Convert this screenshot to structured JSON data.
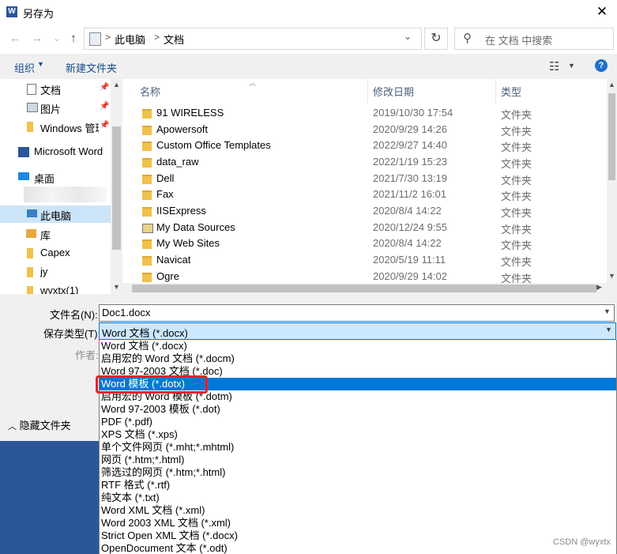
{
  "window": {
    "title": "另存为",
    "close_glyph": "✕"
  },
  "address": {
    "back": "←",
    "forward": "→",
    "recent": "⌄",
    "up": "↑",
    "segments": [
      "此电脑",
      "文档"
    ],
    "separator": ">",
    "dropdown": "⌄",
    "refresh": "↻",
    "search_placeholder": "在 文档 中搜索"
  },
  "toolbar": {
    "organize": "组织",
    "new_folder": "新建文件夹",
    "help": "?"
  },
  "nav": {
    "items": [
      {
        "label": "文档",
        "icon": "document-icon",
        "pinned": true
      },
      {
        "label": "图片",
        "icon": "picture-icon",
        "pinned": true
      },
      {
        "label": "Windows 管理",
        "icon": "folder-icon",
        "pinned": true
      },
      {
        "label": "Microsoft Word",
        "icon": "word-icon",
        "pinned": false
      },
      {
        "label": "桌面",
        "icon": "desktop-icon",
        "pinned": false
      },
      {
        "label": "此电脑",
        "icon": "computer-icon",
        "pinned": false
      },
      {
        "label": "库",
        "icon": "library-icon",
        "pinned": false
      },
      {
        "label": "Capex",
        "icon": "folder-icon",
        "pinned": false
      },
      {
        "label": "jy",
        "icon": "folder-icon",
        "pinned": false
      },
      {
        "label": "wyxtx(1)",
        "icon": "folder-icon",
        "pinned": false
      }
    ],
    "selected": "此电脑"
  },
  "filelist": {
    "columns": {
      "name": "名称",
      "date": "修改日期",
      "type": "类型"
    },
    "rows": [
      {
        "name": "91 WIRELESS",
        "date": "2019/10/30 17:54",
        "type": "文件夹"
      },
      {
        "name": "Apowersoft",
        "date": "2020/9/29 14:26",
        "type": "文件夹"
      },
      {
        "name": "Custom Office Templates",
        "date": "2022/9/27 14:40",
        "type": "文件夹"
      },
      {
        "name": "data_raw",
        "date": "2022/1/19 15:23",
        "type": "文件夹"
      },
      {
        "name": "Dell",
        "date": "2021/7/30 13:19",
        "type": "文件夹"
      },
      {
        "name": "Fax",
        "date": "2021/11/2 16:01",
        "type": "文件夹"
      },
      {
        "name": "IISExpress",
        "date": "2020/8/4 14:22",
        "type": "文件夹"
      },
      {
        "name": "My Data Sources",
        "date": "2020/12/24 9:55",
        "type": "文件夹"
      },
      {
        "name": "My Web Sites",
        "date": "2020/8/4 14:22",
        "type": "文件夹"
      },
      {
        "name": "Navicat",
        "date": "2020/5/19 11:11",
        "type": "文件夹"
      },
      {
        "name": "Ogre",
        "date": "2020/9/29 14:02",
        "type": "文件夹"
      }
    ]
  },
  "form": {
    "filename_label": "文件名(N):",
    "filename_value": "Doc1.docx",
    "filetype_label": "保存类型(T):",
    "filetype_value": "Word 文档 (*.docx)",
    "author_label": "作者:",
    "hide_folders": "隐藏文件夹"
  },
  "filetype_options": [
    "Word 文档 (*.docx)",
    "启用宏的 Word 文档 (*.docm)",
    "Word 97-2003 文档 (*.doc)",
    "Word 模板 (*.dotx)",
    "启用宏的 Word 模板 (*.dotm)",
    "Word 97-2003 模板 (*.dot)",
    "PDF (*.pdf)",
    "XPS 文档 (*.xps)",
    "单个文件网页 (*.mht;*.mhtml)",
    "网页 (*.htm;*.html)",
    "筛选过的网页 (*.htm;*.html)",
    "RTF 格式 (*.rtf)",
    "纯文本 (*.txt)",
    "Word XML 文档 (*.xml)",
    "Word 2003 XML 文档 (*.xml)",
    "Strict Open XML 文档 (*.docx)",
    "OpenDocument 文本 (*.odt)"
  ],
  "selected_option": "Word 模板 (*.dotx)",
  "watermark": "CSDN @wyxtx",
  "colors": {
    "accent": "#0078d7",
    "word_blue": "#2b579a",
    "highlight_red": "#e8212a"
  }
}
